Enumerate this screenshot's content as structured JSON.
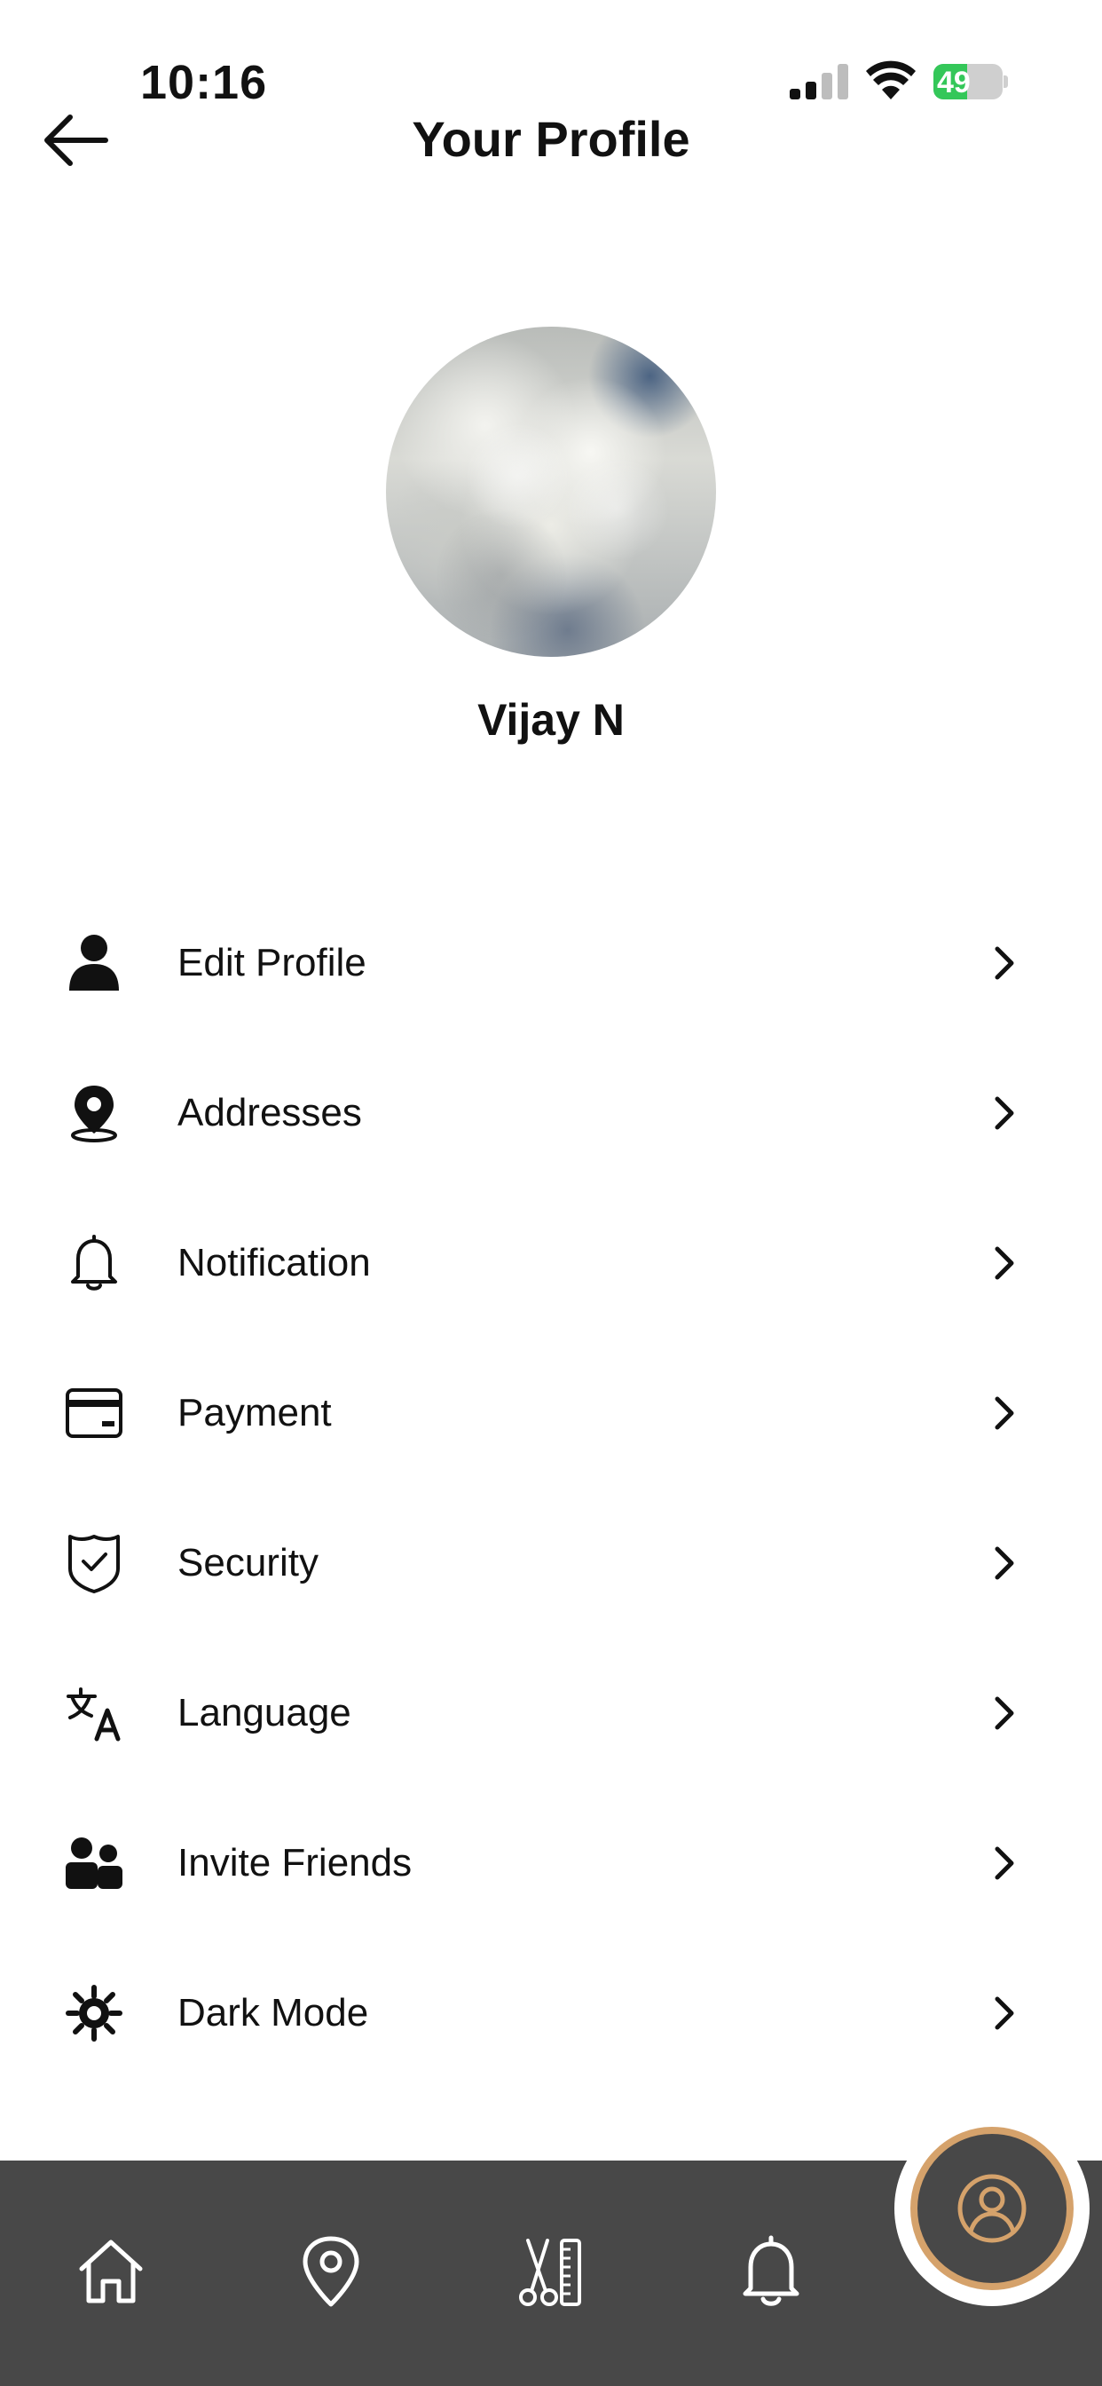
{
  "status_bar": {
    "time": "10:16",
    "battery_percent": "49",
    "battery_level": 0.49,
    "battery_color": "#34c759"
  },
  "header": {
    "title": "Your Profile",
    "back_icon": "arrow-left-icon"
  },
  "profile": {
    "name": "Vijay N"
  },
  "menu": {
    "items": [
      {
        "label": "Edit Profile",
        "icon": "user-icon"
      },
      {
        "label": "Addresses",
        "icon": "location-pin-icon"
      },
      {
        "label": "Notification",
        "icon": "bell-icon"
      },
      {
        "label": "Payment",
        "icon": "credit-card-icon"
      },
      {
        "label": "Security",
        "icon": "shield-check-icon"
      },
      {
        "label": "Language",
        "icon": "translate-icon"
      },
      {
        "label": "Invite Friends",
        "icon": "friends-icon"
      },
      {
        "label": "Dark Mode",
        "icon": "sun-gear-icon"
      }
    ]
  },
  "bottom_nav": {
    "items": [
      "home-icon",
      "map-pin-icon",
      "scissors-comb-icon",
      "bell-icon",
      "profile-icon"
    ],
    "active": "profile-icon",
    "bar_color": "#484848",
    "accent_color": "#d5a26b"
  }
}
